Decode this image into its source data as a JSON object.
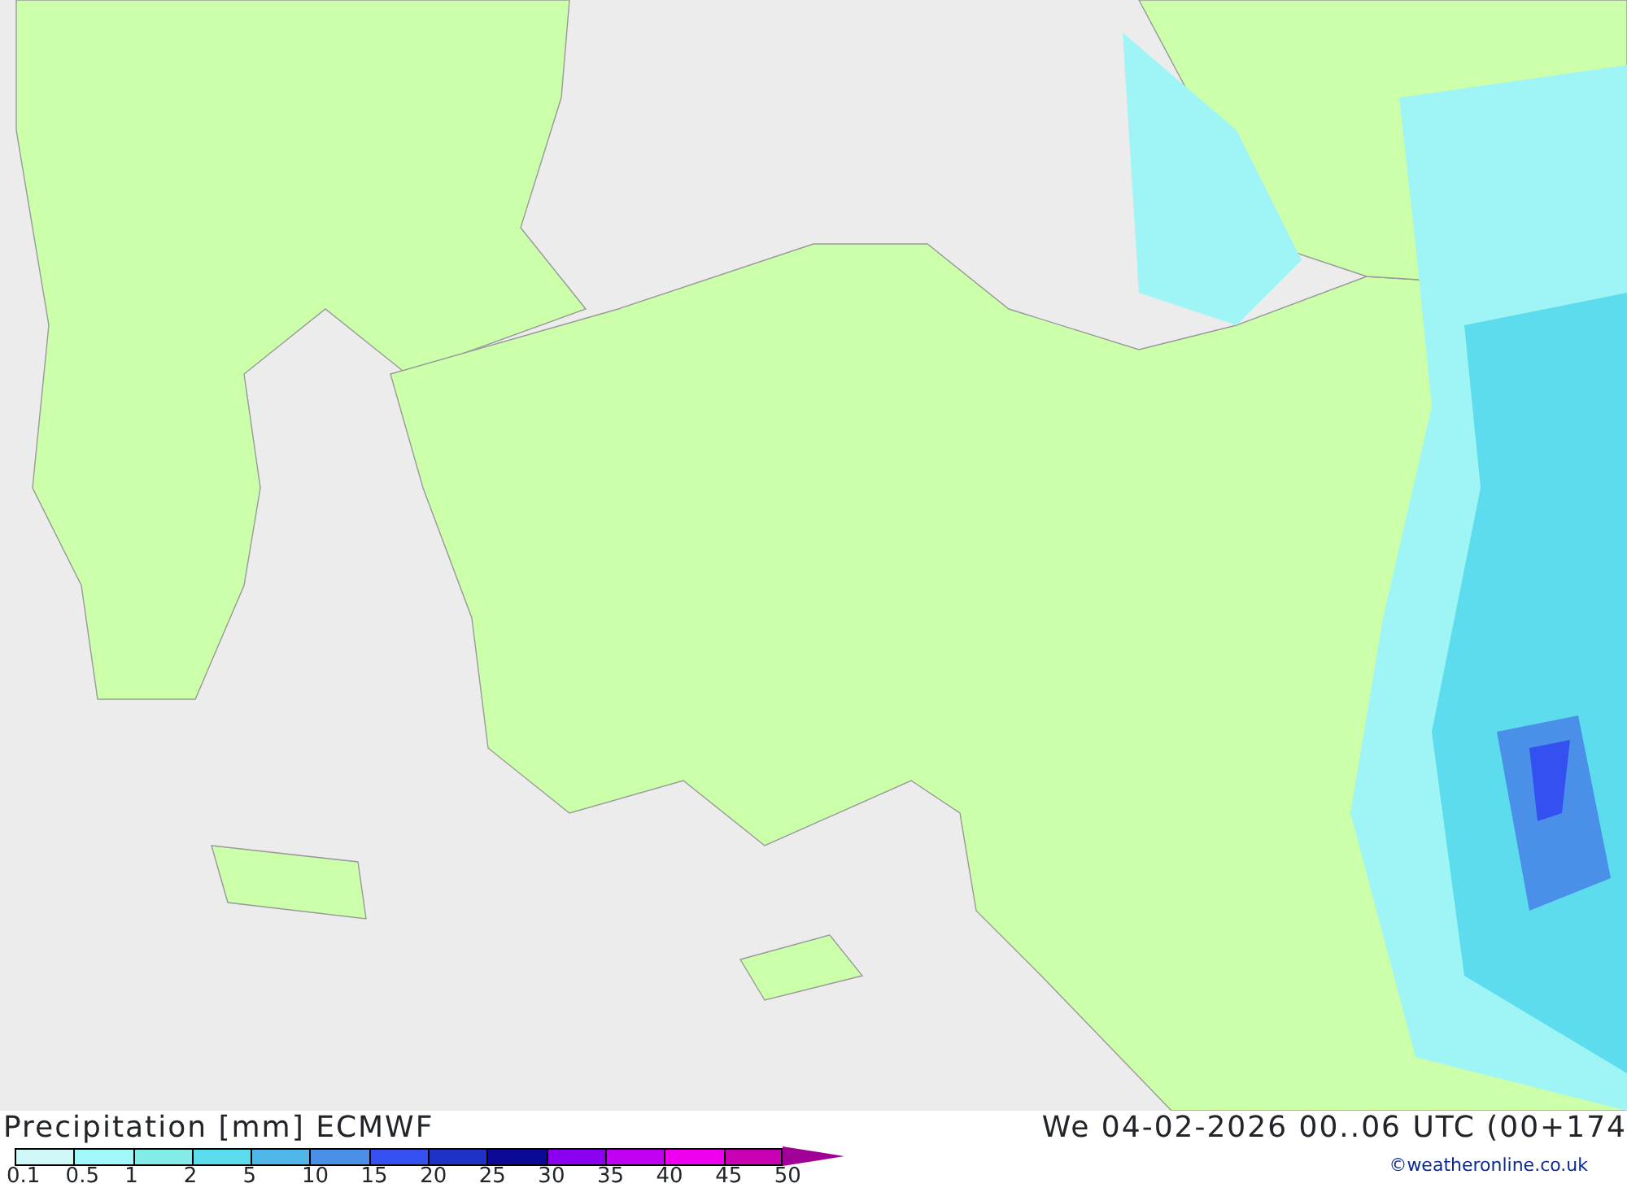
{
  "map": {
    "title": "Precipitation [mm] ECMWF",
    "valid_time": "We 04-02-2026 00..06 UTC (00+174"
  },
  "legend": {
    "steps": [
      {
        "color": "#cff7f7"
      },
      {
        "color": "#a0f8f8"
      },
      {
        "color": "#84ece6"
      },
      {
        "color": "#5cdcec"
      },
      {
        "color": "#50b8e8"
      },
      {
        "color": "#4a90e8"
      },
      {
        "color": "#3450f0"
      },
      {
        "color": "#1e32c8"
      },
      {
        "color": "#0a0a96"
      },
      {
        "color": "#8c00f0"
      },
      {
        "color": "#c000f0"
      },
      {
        "color": "#f000f0"
      },
      {
        "color": "#c800b4"
      }
    ],
    "labels": [
      "0.1",
      "0.5",
      "1",
      "2",
      "5",
      "10",
      "15",
      "20",
      "25",
      "30",
      "35",
      "40",
      "45",
      "50"
    ]
  },
  "credit": "©weatheronline.co.uk"
}
